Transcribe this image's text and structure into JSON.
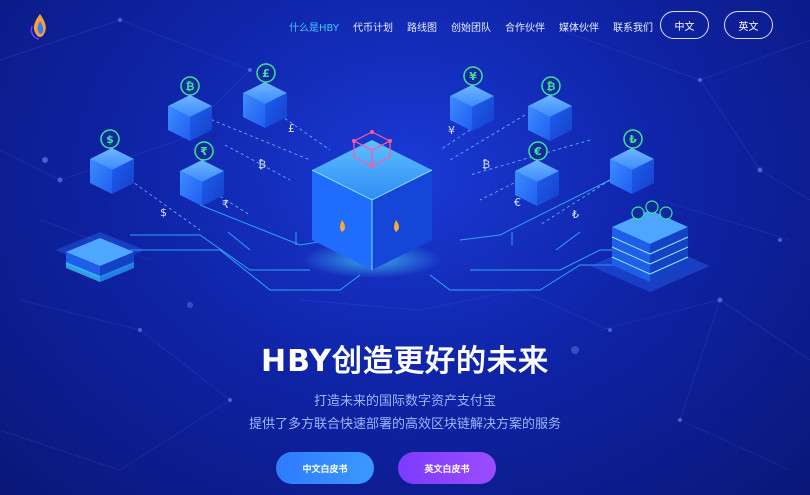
{
  "nav": {
    "items": [
      "什么是HBY",
      "代币计划",
      "路线图",
      "创始团队",
      "合作伙伴",
      "媒体伙伴",
      "联系我们"
    ],
    "active_index": 0
  },
  "lang": {
    "chinese": "中文",
    "english": "英文"
  },
  "hero": {
    "title": "HBY创造更好的未来",
    "subtitle_line1": "打造未来的国际数字资产支付宝",
    "subtitle_line2": "提供了多方联合快速部署的高效区块链解决方案的服务"
  },
  "buttons": {
    "chinese_whitepaper": "中文白皮书",
    "english_whitepaper": "英文白皮书"
  },
  "illustration": {
    "currency_symbols": [
      "$",
      "₿",
      "£",
      "₹",
      "¥",
      "₿",
      "€",
      "₺"
    ],
    "flow_symbols": [
      "$",
      "₹",
      "₿",
      "£",
      "¥",
      "₿",
      "€",
      "₺"
    ]
  },
  "colors": {
    "background": "#1230b8",
    "accent": "#46c7ff",
    "cube": "#2a7bff",
    "coin_green": "#3fe0a0",
    "whitepaper_cn": "#2f7bff",
    "whitepaper_en": "#8a44ff"
  }
}
